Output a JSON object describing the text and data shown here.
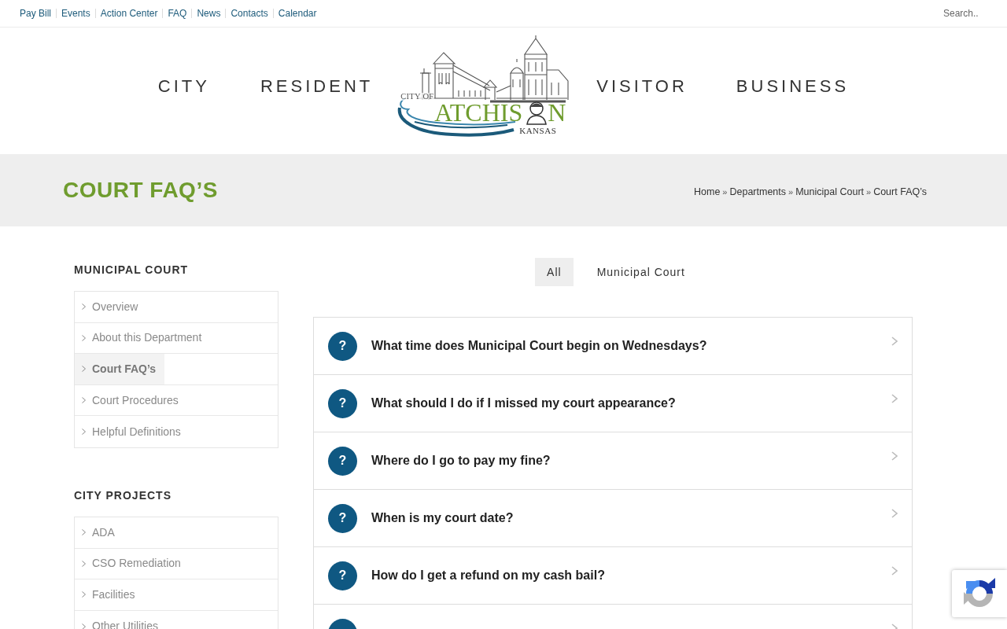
{
  "top_links": [
    "Pay Bill",
    "Events",
    "Action Center",
    "FAQ",
    "News",
    "Contacts",
    "Calendar"
  ],
  "search": {
    "placeholder": "Search.."
  },
  "main_nav": {
    "left": [
      "CITY",
      "RESIDENT"
    ],
    "right": [
      "VISITOR",
      "BUSINESS"
    ]
  },
  "logo": {
    "prefix": "CITY OF",
    "name_start": "ATCHIS",
    "name_end": "N",
    "state": "KANSAS"
  },
  "page_title": "COURT FAQ’S",
  "breadcrumb": [
    {
      "label": "Home",
      "separator": "»"
    },
    {
      "label": "Departments",
      "separator": "»"
    },
    {
      "label": "Municipal Court",
      "separator": "»"
    },
    {
      "label": "Court FAQ’s"
    }
  ],
  "sidebar": [
    {
      "heading": "MUNICIPAL COURT",
      "items": [
        {
          "label": "Overview",
          "selected": false
        },
        {
          "label": "About this Department",
          "selected": false
        },
        {
          "label": "Court FAQ’s",
          "selected": true
        },
        {
          "label": "Court Procedures",
          "selected": false
        },
        {
          "label": "Helpful Definitions",
          "selected": false
        }
      ]
    },
    {
      "heading": "CITY PROJECTS",
      "items": [
        {
          "label": "ADA",
          "selected": false
        },
        {
          "label": "CSO Remediation",
          "selected": false
        },
        {
          "label": "Facilities",
          "selected": false
        },
        {
          "label": "Other Utilities",
          "selected": false
        }
      ]
    }
  ],
  "filters": [
    {
      "label": "All",
      "selected": true
    },
    {
      "label": "Municipal Court",
      "selected": false
    }
  ],
  "faqs": [
    {
      "kind": "question",
      "badge": "?",
      "question": "What time does Municipal Court begin on Wednesdays?"
    },
    {
      "kind": "question",
      "badge": "?",
      "question": "What should I do if I missed my court appearance?"
    },
    {
      "kind": "question",
      "badge": "?",
      "question": "Where do I go to pay my fine?"
    },
    {
      "kind": "question",
      "badge": "?",
      "question": "When is my court date?"
    },
    {
      "kind": "question",
      "badge": "?",
      "question": "How do I get a refund on my cash bail?"
    },
    {
      "kind": "partial"
    }
  ]
}
